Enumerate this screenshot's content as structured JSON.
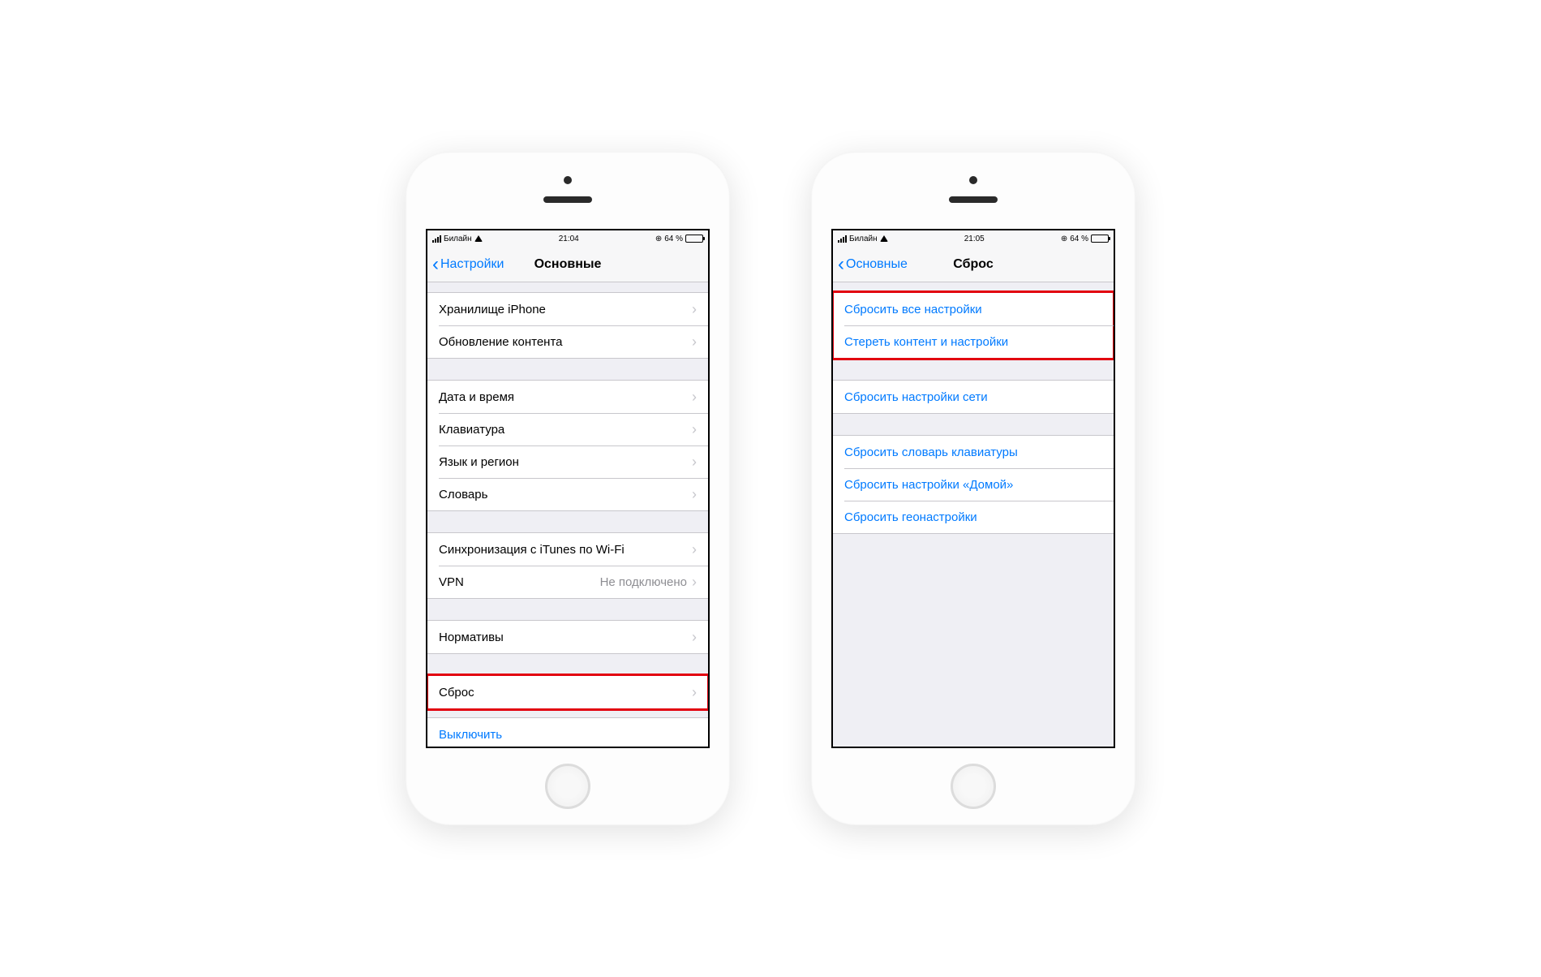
{
  "phone_left": {
    "statusbar": {
      "carrier": "Билайн",
      "time": "21:04",
      "battery": "64 %"
    },
    "nav": {
      "back": "Настройки",
      "title": "Основные"
    },
    "groups": [
      {
        "rows": [
          {
            "label": "Хранилище iPhone",
            "chevron": true
          },
          {
            "label": "Обновление контента",
            "chevron": true
          }
        ]
      },
      {
        "rows": [
          {
            "label": "Дата и время",
            "chevron": true
          },
          {
            "label": "Клавиатура",
            "chevron": true
          },
          {
            "label": "Язык и регион",
            "chevron": true
          },
          {
            "label": "Словарь",
            "chevron": true
          }
        ]
      },
      {
        "rows": [
          {
            "label": "Синхронизация с iTunes по Wi-Fi",
            "chevron": true
          },
          {
            "label": "VPN",
            "detail": "Не подключено",
            "chevron": true
          }
        ]
      },
      {
        "rows": [
          {
            "label": "Нормативы",
            "chevron": true
          }
        ]
      },
      {
        "highlight": true,
        "rows": [
          {
            "label": "Сброс",
            "chevron": true
          }
        ]
      },
      {
        "tight": true,
        "rows": [
          {
            "label": "Выключить",
            "action": true
          }
        ]
      }
    ]
  },
  "phone_right": {
    "statusbar": {
      "carrier": "Билайн",
      "time": "21:05",
      "battery": "64 %"
    },
    "nav": {
      "back": "Основные",
      "title": "Сброс"
    },
    "groups": [
      {
        "highlight": true,
        "rows": [
          {
            "label": "Сбросить все настройки",
            "action": true
          },
          {
            "label": "Стереть контент и настройки",
            "action": true
          }
        ]
      },
      {
        "rows": [
          {
            "label": "Сбросить настройки сети",
            "action": true
          }
        ]
      },
      {
        "rows": [
          {
            "label": "Сбросить словарь клавиатуры",
            "action": true
          },
          {
            "label": "Сбросить настройки «Домой»",
            "action": true
          },
          {
            "label": "Сбросить геонастройки",
            "action": true
          }
        ]
      }
    ]
  }
}
